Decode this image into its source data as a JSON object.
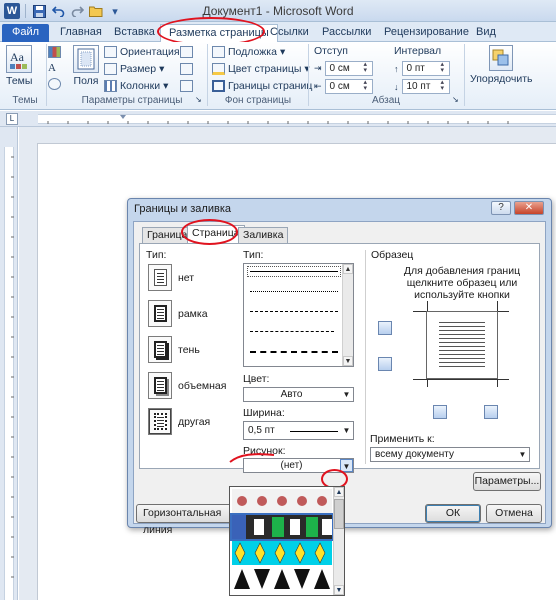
{
  "window": {
    "title": "Документ1 - Microsoft Word",
    "app_icon_letter": "W"
  },
  "quick_access": [
    {
      "name": "save-icon",
      "glyph": "▪"
    },
    {
      "name": "undo-icon",
      "glyph": "↶"
    },
    {
      "name": "redo-icon",
      "glyph": "↷"
    },
    {
      "name": "open-folder-icon",
      "glyph": "▭"
    },
    {
      "name": "customize-icon",
      "glyph": "▾"
    }
  ],
  "ribbon_tabs": {
    "file": "Файл",
    "home": "Главная",
    "insert": "Вставка",
    "page_layout": "Разметка страницы",
    "references": "Ссылки",
    "mailings": "Рассылки",
    "review": "Рецензирование",
    "view": "Вид"
  },
  "ribbon": {
    "themes": {
      "label": "Темы",
      "group": "Темы"
    },
    "margins": {
      "label": "Поля"
    },
    "orientation": "Ориентация",
    "size": "Размер",
    "columns": "Колонки",
    "page_setup_group": "Параметры страницы",
    "watermark": "Подложка",
    "page_color": "Цвет страницы",
    "page_borders": "Границы страниц",
    "page_background_group": "Фон страницы",
    "indent_head": "Отступ",
    "indent_left": "0 см",
    "indent_right": "0 см",
    "spacing_head": "Интервал",
    "spacing_before": "0 пт",
    "spacing_after": "10 пт",
    "paragraph_group": "Абзац",
    "arrange": "Упорядочить"
  },
  "dialog": {
    "title": "Границы и заливка",
    "help": "?",
    "close": "✕",
    "tabs": {
      "borders": "Граница",
      "page": "Страница",
      "shading": "Заливка"
    },
    "setting_label": "Тип:",
    "settings": [
      "нет",
      "рамка",
      "тень",
      "объемная",
      "другая"
    ],
    "style_label": "Тип:",
    "color_label": "Цвет:",
    "color_value": "Авто",
    "width_label": "Ширина:",
    "width_value": "0,5 пт",
    "art_label": "Рисунок:",
    "art_value": "(нет)",
    "preview_label": "Образец",
    "preview_hint": "Для добавления границ щелкните образец или используйте кнопки",
    "apply_label": "Применить к:",
    "apply_value": "всему документу",
    "options_button": "Параметры...",
    "horizontal_line_button": "Горизонтальная линия",
    "ok_button": "ОК",
    "cancel_button": "Отмена"
  },
  "colors": {
    "accent_red": "#e0131f",
    "file_tab": "#2a64c0",
    "dialog_frame": "#c4d6ec"
  }
}
